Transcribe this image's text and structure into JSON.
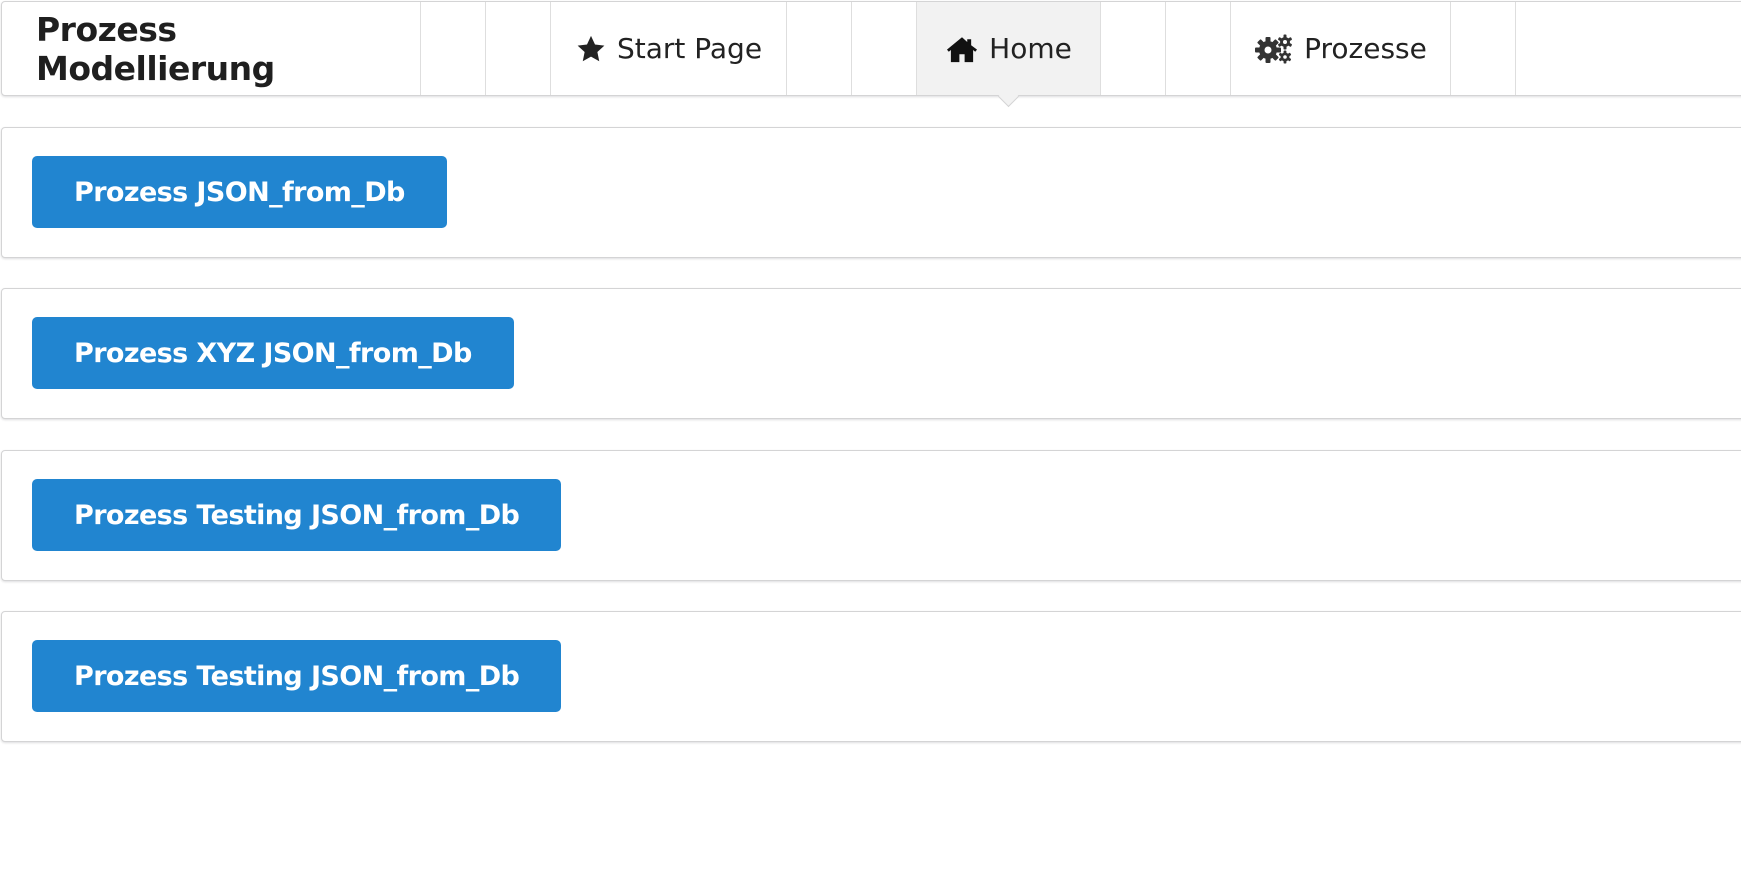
{
  "header": {
    "title": "Prozess Modellierung",
    "nav": [
      {
        "label": "Start Page",
        "icon": "star-icon",
        "active": false
      },
      {
        "label": "Home",
        "icon": "home-icon",
        "active": true
      },
      {
        "label": "Prozesse",
        "icon": "gears-icon",
        "active": false
      }
    ]
  },
  "processes": [
    {
      "label": "Prozess JSON_from_Db"
    },
    {
      "label": "Prozess XYZ JSON_from_Db"
    },
    {
      "label": "Prozess Testing JSON_from_Db"
    },
    {
      "label": "Prozess Testing JSON_from_Db"
    }
  ],
  "colors": {
    "primary_button": "#2185d0",
    "active_item_bg": "#f2f2f2"
  }
}
